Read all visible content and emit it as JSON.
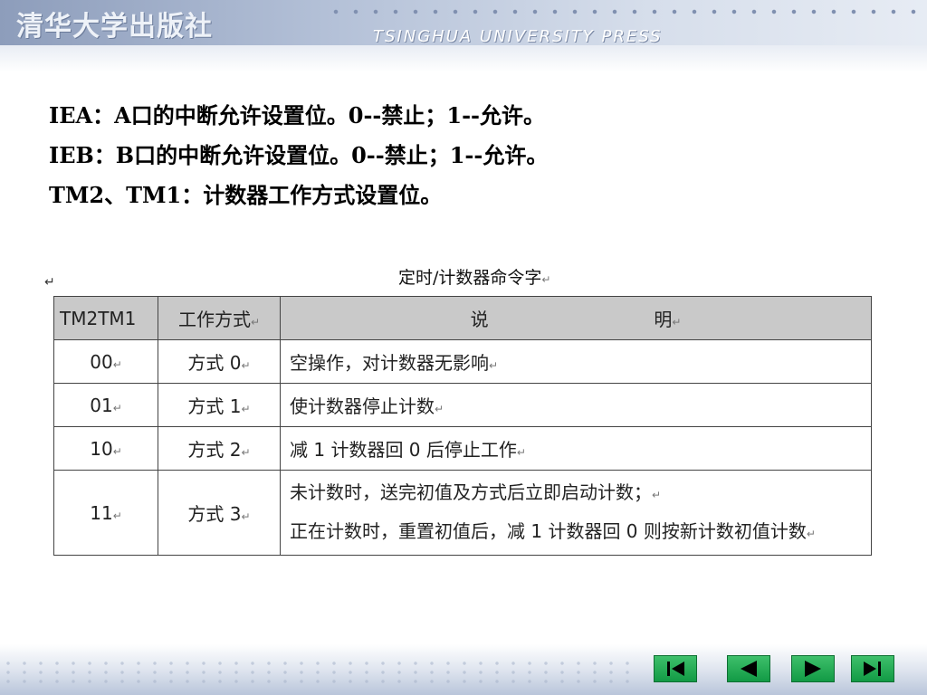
{
  "header": {
    "logo_cn": "清华大学出版社",
    "logo_en": "TSINGHUA UNIVERSITY PRESS"
  },
  "content": {
    "lines": [
      "IEA：A口的中断允许设置位。0--禁止；1--允许。",
      "IEB：B口的中断允许设置位。0--禁止；1--允许。",
      "TM2、TM1：计数器工作方式设置位。"
    ]
  },
  "table": {
    "title": "定时/计数器命令字",
    "headers": [
      "TM2TM1",
      "工作方式",
      "说",
      "明"
    ],
    "rows": [
      {
        "code": "00",
        "mode": "方式 0",
        "desc": [
          "空操作，对计数器无影响"
        ]
      },
      {
        "code": "01",
        "mode": "方式 1",
        "desc": [
          "使计数器停止计数"
        ]
      },
      {
        "code": "10",
        "mode": "方式 2",
        "desc": [
          "减 1 计数器回 0 后停止工作"
        ]
      },
      {
        "code": "11",
        "mode": "方式 3",
        "desc": [
          "未计数时，送完初值及方式后立即启动计数；",
          "正在计数时，重置初值后，减 1 计数器回 0 则按新计数初值计数"
        ]
      }
    ]
  },
  "nav": {
    "buttons": [
      "first",
      "previous",
      "next",
      "last"
    ],
    "color": "#1fa651"
  }
}
